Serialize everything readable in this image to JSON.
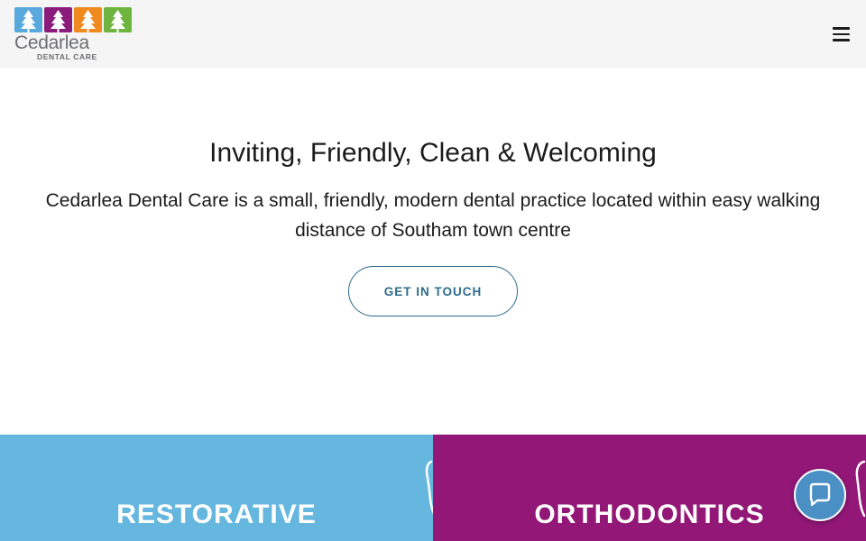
{
  "header": {
    "logo": {
      "name": "Cedarlea",
      "subtitle": "DENTAL CARE",
      "tile_colors": [
        "#5aa9dd",
        "#8a1c7c",
        "#f08a1e",
        "#6fb43f"
      ]
    },
    "menu_icon": "hamburger-menu-icon"
  },
  "hero": {
    "title": "Inviting, Friendly, Clean & Welcoming",
    "description": "Cedarlea Dental Care is a small, friendly, modern dental practice located within easy walking distance of Southam town centre",
    "cta_label": "GET IN TOUCH"
  },
  "services": [
    {
      "label": "RESTORATIVE",
      "color": "#66b7df",
      "icon": "tooth-icon"
    },
    {
      "label": "ORTHODONTICS",
      "color": "#931777",
      "icon": "tooth-icon"
    }
  ],
  "chat": {
    "icon": "chat-bubble-icon"
  },
  "colors": {
    "accent": "#2d6b8a",
    "header_bg": "#f5f5f5"
  }
}
